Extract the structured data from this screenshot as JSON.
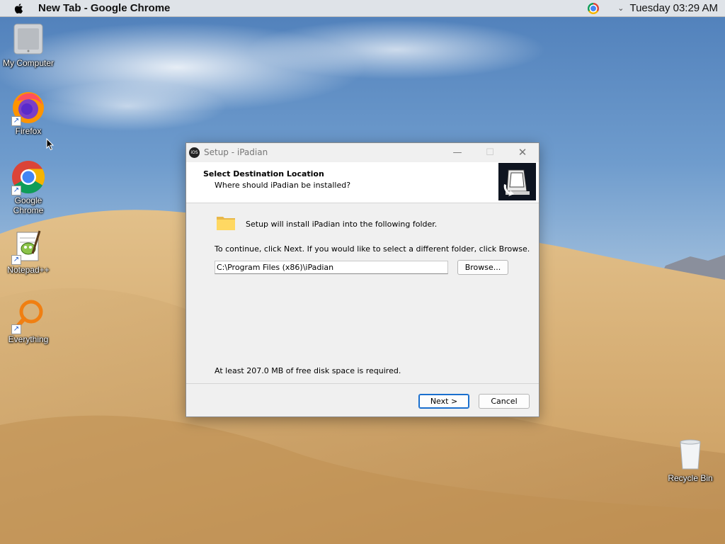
{
  "menubar": {
    "app_title": "New Tab - Google Chrome",
    "clock": "Tuesday 03:29 AM",
    "icons": [
      "apple-icon",
      "chrome-icon",
      "chevron-down-icon"
    ]
  },
  "desktop": {
    "icons": [
      {
        "label": "My Computer",
        "icon": "computer-icon"
      },
      {
        "label": "Firefox",
        "icon": "firefox-icon"
      },
      {
        "label": "Google Chrome",
        "icon": "chrome-icon"
      },
      {
        "label": "Notepad++",
        "icon": "notepadpp-icon"
      },
      {
        "label": "Everything",
        "icon": "everything-icon"
      },
      {
        "label": "Recycle Bin",
        "icon": "recycle-bin-icon"
      }
    ]
  },
  "dialog": {
    "badge": "iOS",
    "title": "Setup - iPadian",
    "header_title": "Select Destination Location",
    "header_subtitle": "Where should iPadian be installed?",
    "info_text": "Setup will install iPadian into the following folder.",
    "instruction": "To continue, click Next. If you would like to select a different folder, click Browse.",
    "path_value": "C:\\Program Files (x86)\\iPadian",
    "browse_label": "Browse...",
    "disk_space": "At least 207.0 MB of free disk space is required.",
    "next_label": "Next >",
    "cancel_label": "Cancel"
  }
}
